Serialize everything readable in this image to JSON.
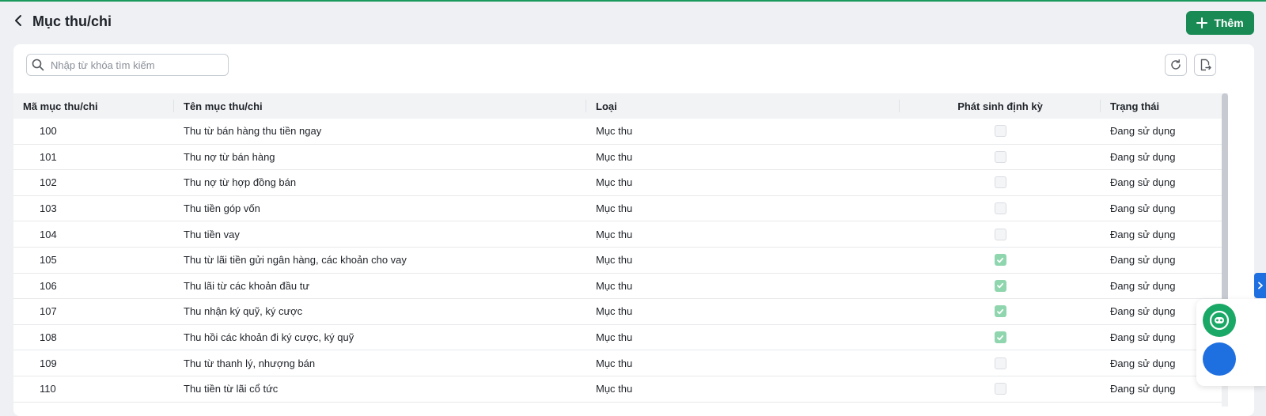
{
  "header": {
    "title": "Mục thu/chi",
    "add_label": "Thêm"
  },
  "search": {
    "placeholder": "Nhập từ khóa tìm kiếm",
    "value": ""
  },
  "table": {
    "columns": [
      "Mã mục thu/chi",
      "Tên mục thu/chi",
      "Loại",
      "Phát sinh định kỳ",
      "Trạng thái"
    ],
    "rows": [
      {
        "code": "100",
        "name": "Thu từ bán hàng thu tiền ngay",
        "type": "Mục thu",
        "recurring": false,
        "status": "Đang sử dụng"
      },
      {
        "code": "101",
        "name": "Thu nợ từ bán hàng",
        "type": "Mục thu",
        "recurring": false,
        "status": "Đang sử dụng"
      },
      {
        "code": "102",
        "name": "Thu nợ từ hợp đồng bán",
        "type": "Mục thu",
        "recurring": false,
        "status": "Đang sử dụng"
      },
      {
        "code": "103",
        "name": "Thu tiền góp vốn",
        "type": "Mục thu",
        "recurring": false,
        "status": "Đang sử dụng"
      },
      {
        "code": "104",
        "name": "Thu tiền vay",
        "type": "Mục thu",
        "recurring": false,
        "status": "Đang sử dụng"
      },
      {
        "code": "105",
        "name": "Thu từ lãi tiền gửi ngân hàng, các khoản cho vay",
        "type": "Mục thu",
        "recurring": true,
        "status": "Đang sử dụng"
      },
      {
        "code": "106",
        "name": "Thu lãi từ các khoản đầu tư",
        "type": "Mục thu",
        "recurring": true,
        "status": "Đang sử dụng"
      },
      {
        "code": "107",
        "name": "Thu nhận ký quỹ, ký cược",
        "type": "Mục thu",
        "recurring": true,
        "status": "Đang sử dụng"
      },
      {
        "code": "108",
        "name": "Thu hồi các khoản đi ký cược, ký quỹ",
        "type": "Mục thu",
        "recurring": true,
        "status": "Đang sử dụng"
      },
      {
        "code": "109",
        "name": "Thu từ thanh lý, nhượng bán",
        "type": "Mục thu",
        "recurring": false,
        "status": "Đang sử dụng"
      },
      {
        "code": "110",
        "name": "Thu tiền từ lãi cổ tức",
        "type": "Mục thu",
        "recurring": false,
        "status": "Đang sử dụng"
      }
    ]
  },
  "colors": {
    "accent": "#1a8a55",
    "checked": "#8fd6ae",
    "side_tab": "#1e6fe0",
    "chat": "#1aa866"
  },
  "icons": {
    "back": "chevron-left-icon",
    "add": "plus-icon",
    "search": "search-icon",
    "refresh": "refresh-icon",
    "export": "export-icon",
    "chat": "chat-bot-icon"
  }
}
